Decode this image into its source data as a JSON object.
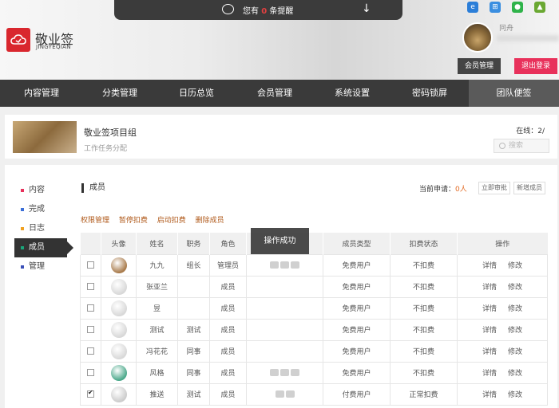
{
  "notice": {
    "prefix": "您有",
    "count": "0",
    "suffix": "条提醒"
  },
  "brand": {
    "name": "敬业签",
    "sub": "JINGYEQIAN"
  },
  "user": {
    "name": "冋舟",
    "member_btn": "会员管理",
    "logout_btn": "退出登录"
  },
  "nav": [
    "内容管理",
    "分类管理",
    "日历总览",
    "会员管理",
    "系统设置",
    "密码锁屏",
    "团队便签"
  ],
  "project": {
    "title": "敬业签项目组",
    "subtitle": "工作任务分配",
    "online_label": "在线：",
    "online_value": "2/",
    "search_placeholder": "搜索"
  },
  "sidebar": [
    {
      "label": "内容",
      "color": "#e8315b"
    },
    {
      "label": "完成",
      "color": "#3b6fd8"
    },
    {
      "label": "日志",
      "color": "#f0a020"
    },
    {
      "label": "成员",
      "color": "#1aa57a"
    },
    {
      "label": "管理",
      "color": "#3b4fb8"
    }
  ],
  "section": {
    "title": "成员",
    "pending_label": "当前申请：",
    "pending_value": "0人",
    "approve_btn": "立即审批",
    "add_btn": "新增成员"
  },
  "actions": [
    "权限管理",
    "暂停扣费",
    "启动扣费",
    "删除成员"
  ],
  "table": {
    "headers": [
      "头像",
      "姓名",
      "职务",
      "角色",
      "",
      "成员类型",
      "扣费状态",
      "操作"
    ],
    "rows": [
      {
        "name": "九九",
        "title": "组长",
        "role": "管理员",
        "msgs": 3,
        "type": "免费用户",
        "status": "不扣费",
        "avatar": "#a87a4a",
        "checked": false
      },
      {
        "name": "张亚兰",
        "title": "",
        "role": "成员",
        "msgs": 0,
        "type": "免费用户",
        "status": "不扣费",
        "avatar": "#d8d8d8",
        "checked": false
      },
      {
        "name": "昱",
        "title": "",
        "role": "成员",
        "msgs": 0,
        "type": "免费用户",
        "status": "不扣费",
        "avatar": "#d8d8d8",
        "checked": false
      },
      {
        "name": "测试",
        "title": "测试",
        "role": "成员",
        "msgs": 0,
        "type": "免费用户",
        "status": "不扣费",
        "avatar": "#d8d8d8",
        "checked": false
      },
      {
        "name": "冯花花",
        "title": "同事",
        "role": "成员",
        "msgs": 0,
        "type": "免费用户",
        "status": "不扣费",
        "avatar": "#d8d8d8",
        "checked": false
      },
      {
        "name": "风格",
        "title": "同事",
        "role": "成员",
        "msgs": 3,
        "type": "免费用户",
        "status": "不扣费",
        "avatar": "#4aa88a",
        "checked": false
      },
      {
        "name": "推送",
        "title": "测试",
        "role": "成员",
        "msgs": 2,
        "type": "付费用户",
        "status": "正常扣费",
        "avatar": "#cccccc",
        "checked": true
      }
    ],
    "detail_label": "详情",
    "edit_label": "修改"
  },
  "toast": "操作成功"
}
